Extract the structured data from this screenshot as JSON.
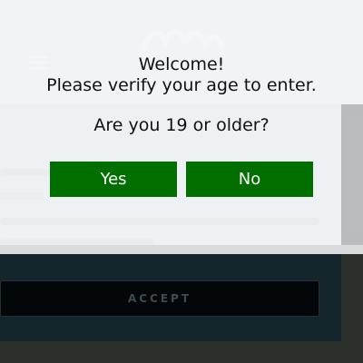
{
  "background": {
    "logo": "",
    "cookie": {
      "title": "",
      "accept_label": "ACCEPT"
    }
  },
  "age_gate": {
    "welcome_line1": "Welcome!",
    "welcome_line2": "Please verify your age to enter.",
    "question": "Are you 19 or older?",
    "yes_label": "Yes",
    "no_label": "No",
    "button_color": "#006f00"
  },
  "icons": [
    "menu-icon",
    "logo-icon"
  ]
}
